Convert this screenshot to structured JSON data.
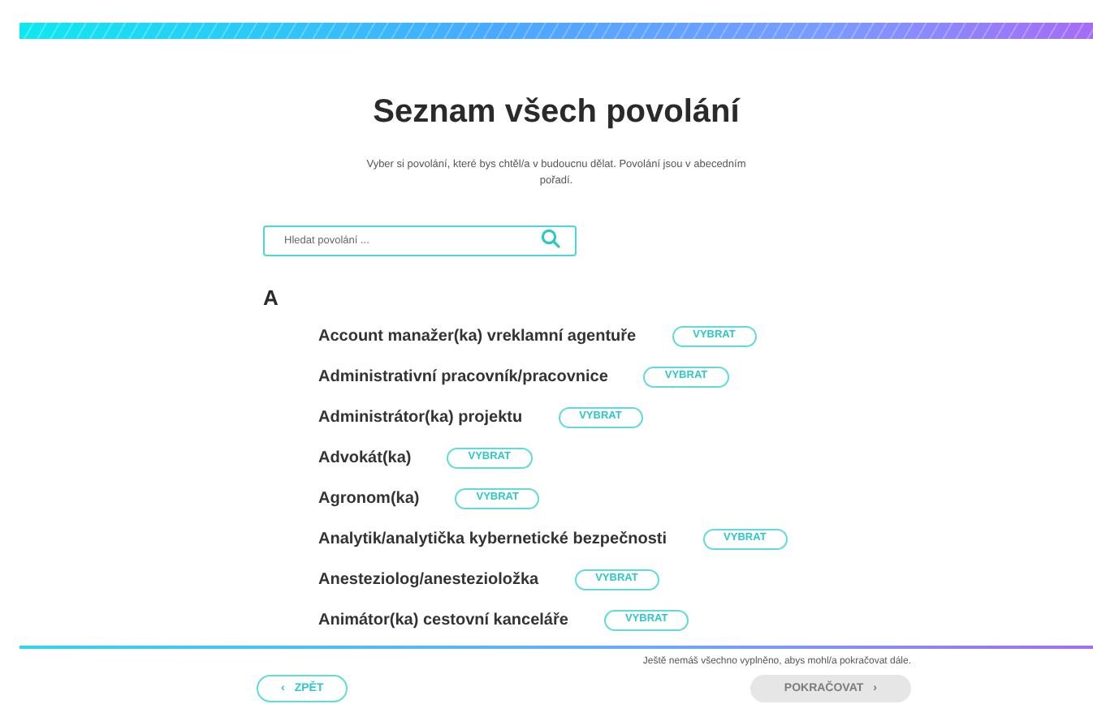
{
  "title": "Seznam všech povolání",
  "subtitle": "Vyber si povolání, které bys chtěl/a v budoucnu dělat. Povolání jsou v abecedním pořadí.",
  "search": {
    "placeholder": "Hledat povolání ..."
  },
  "groups": [
    {
      "letter": "A",
      "items": [
        {
          "name": "Account manažer(ka) vreklamní agentuře",
          "button": "VYBRAT"
        },
        {
          "name": "Administrativní pracovník/pracovnice",
          "button": "VYBRAT"
        },
        {
          "name": "Administrátor(ka) projektu",
          "button": "VYBRAT"
        },
        {
          "name": "Advokát(ka)",
          "button": "VYBRAT"
        },
        {
          "name": "Agronom(ka)",
          "button": "VYBRAT"
        },
        {
          "name": "Analytik/analytička kybernetické bezpečnosti",
          "button": "VYBRAT"
        },
        {
          "name": "Anesteziolog/anestezioložka",
          "button": "VYBRAT"
        },
        {
          "name": "Animátor(ka) cestovní kanceláře",
          "button": "VYBRAT"
        }
      ]
    }
  ],
  "footer": {
    "message": "Ještě nemáš všechno vyplněno, abys mohl/a pokračovat dále.",
    "back": {
      "icon": "‹",
      "label": "ZPĚT",
      "disabled": false
    },
    "next": {
      "icon": "›",
      "label": "POKRAČOVAT",
      "disabled": true
    }
  }
}
